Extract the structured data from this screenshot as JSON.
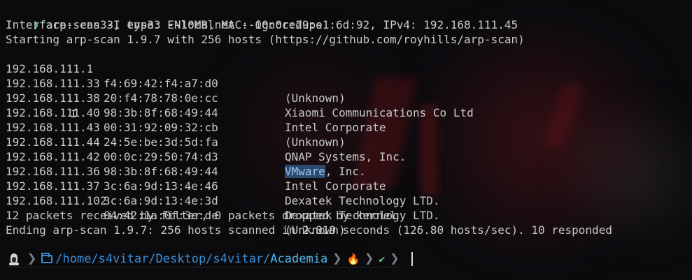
{
  "command": {
    "prompt_symbol": "❯",
    "text": "arp-scan -I ens33 --localnet --ignoredups"
  },
  "output": {
    "interface_line": "Interface: ens33, type: EN10MB, MAC: 00:0c:29:e1:6d:92, IPv4: 192.168.111.45",
    "starting_line": "Starting arp-scan 1.9.7 with 256 hosts (https://github.com/royhills/arp-scan)",
    "hosts": [
      {
        "ip": "192.168.111.1",
        "mac": "f4:69:42:f4:a7:d0",
        "vendor": "(Unknown)"
      },
      {
        "ip": "192.168.111.33",
        "mac": "20:f4:78:78:0e:cc",
        "vendor": "Xiaomi Communications Co Ltd"
      },
      {
        "ip": "192.168.111.38",
        "mac": "98:3b:8f:68:49:44",
        "vendor": "Intel Corporate"
      },
      {
        "ip": "192.168.111.40",
        "mac": "00:31:92:09:32:cb",
        "vendor": "(Unknown)"
      },
      {
        "ip": "192.168.111.43",
        "mac": "24:5e:be:3d:5d:fa",
        "vendor": "QNAP Systems, Inc."
      },
      {
        "ip": "192.168.111.44",
        "mac": "00:0c:29:50:74:d3",
        "vendor_selected": "VMware",
        "vendor_rest": ", Inc."
      },
      {
        "ip": "192.168.111.42",
        "mac": "98:3b:8f:68:49:44",
        "vendor": "Intel Corporate"
      },
      {
        "ip": "192.168.111.36",
        "mac": "3c:6a:9d:13:4e:46",
        "vendor": "Dexatek Technology LTD."
      },
      {
        "ip": "192.168.111.37",
        "mac": "3c:6a:9d:13:4e:3d",
        "vendor": "Dexatek Technology LTD."
      },
      {
        "ip": "192.168.111.102",
        "mac": "04:42:1a:0f:3e:de",
        "vendor": "(Unknown)"
      }
    ],
    "packets_line": "12 packets received by filter, 0 packets dropped by kernel",
    "ending_line": "Ending arp-scan 1.9.7: 256 hosts scanned in 2.019 seconds (126.80 hosts/sec). 10 responded"
  },
  "prompt": {
    "path_prefix": "/home/s4vitar/Desktop/s4vitar/",
    "path_last": "Academia",
    "separator": "❯",
    "fire_symbol": "🔥",
    "check_symbol": "✔"
  },
  "icons": {
    "os": "linux-tux-icon",
    "folder": "folder-icon",
    "fire": "fire-icon",
    "check": "check-icon"
  },
  "colors": {
    "prompt_arrow": "#59c57b",
    "path": "#3a8fd8",
    "selection_bg": "#2c4a6e"
  }
}
